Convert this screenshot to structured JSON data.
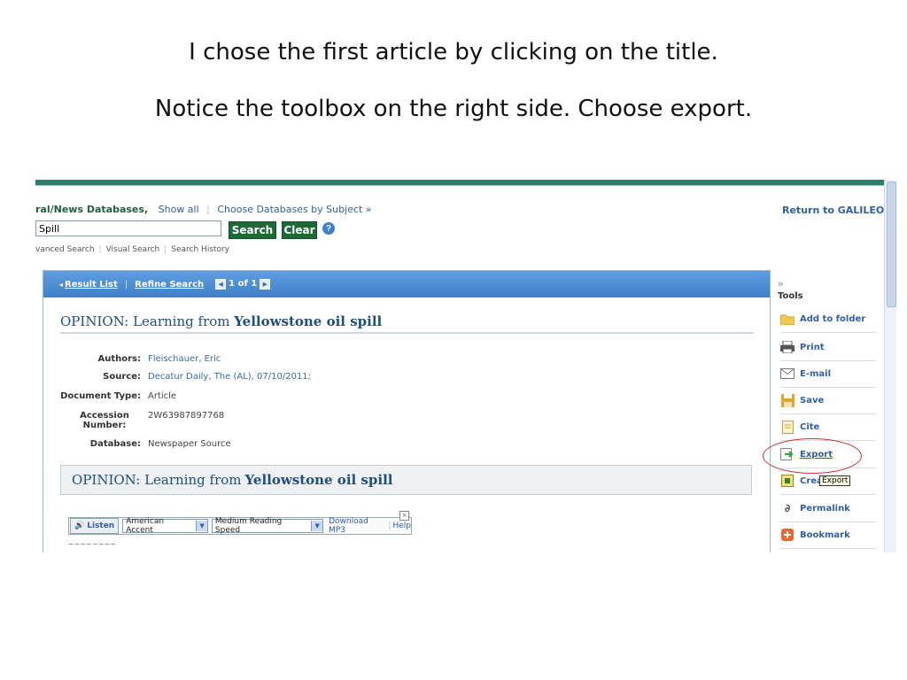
{
  "captions": {
    "line1": "I chose the first article by clicking on the title.",
    "line2": "Notice the toolbox on the right side. Choose export."
  },
  "header": {
    "databases_label": "ral/News Databases,",
    "show_all": "Show all",
    "choose_by_subject": "Choose Databases by Subject »",
    "return_link": "Return to GALILEO"
  },
  "search": {
    "value": "Spill",
    "search_button": "Search",
    "clear_button": "Clear",
    "help_glyph": "?",
    "links": [
      "vanced Search",
      "Visual Search",
      "Search History"
    ]
  },
  "panel": {
    "result_list": "Result List",
    "refine_search": "Refine Search",
    "pager_text": "1 of 1",
    "article_title_prefix": "OPINION: Learning from ",
    "article_title_bold": "Yellowstone oil spill",
    "metadata": [
      {
        "label": "Authors:",
        "value": "Fleischauer, Eric"
      },
      {
        "label": "Source:",
        "value": "Decatur Daily, The (AL), 07/10/2011;"
      },
      {
        "label": "Document Type:",
        "value": "Article"
      },
      {
        "label": "Accession Number:",
        "value": "2W63987897768"
      },
      {
        "label": "Database:",
        "value": "Newspaper Source"
      }
    ],
    "listen": {
      "button": "Listen",
      "accent": "American Accent",
      "speed": "Medium Reading Speed",
      "download": "Download MP3",
      "help": "Help"
    },
    "tilde": "~~~~~~~~"
  },
  "tools": {
    "chevron": "»",
    "title": "Tools",
    "items": [
      {
        "label": "Add to folder",
        "icon": "folder-icon"
      },
      {
        "label": "Print",
        "icon": "printer-icon"
      },
      {
        "label": "E-mail",
        "icon": "envelope-icon"
      },
      {
        "label": "Save",
        "icon": "floppy-icon"
      },
      {
        "label": "Cite",
        "icon": "document-icon"
      },
      {
        "label": "Export",
        "icon": "export-icon"
      },
      {
        "label": "Crea",
        "icon": "note-icon"
      },
      {
        "label": "Permalink",
        "icon": "link-icon"
      },
      {
        "label": "Bookmark",
        "icon": "plus-icon"
      }
    ],
    "tooltip": "Export"
  },
  "colors": {
    "accent_green": "#1f6b38",
    "panel_header_blue": "#3f7fc8",
    "link_blue": "#2f5fa8",
    "highlight_red": "#d03030"
  }
}
